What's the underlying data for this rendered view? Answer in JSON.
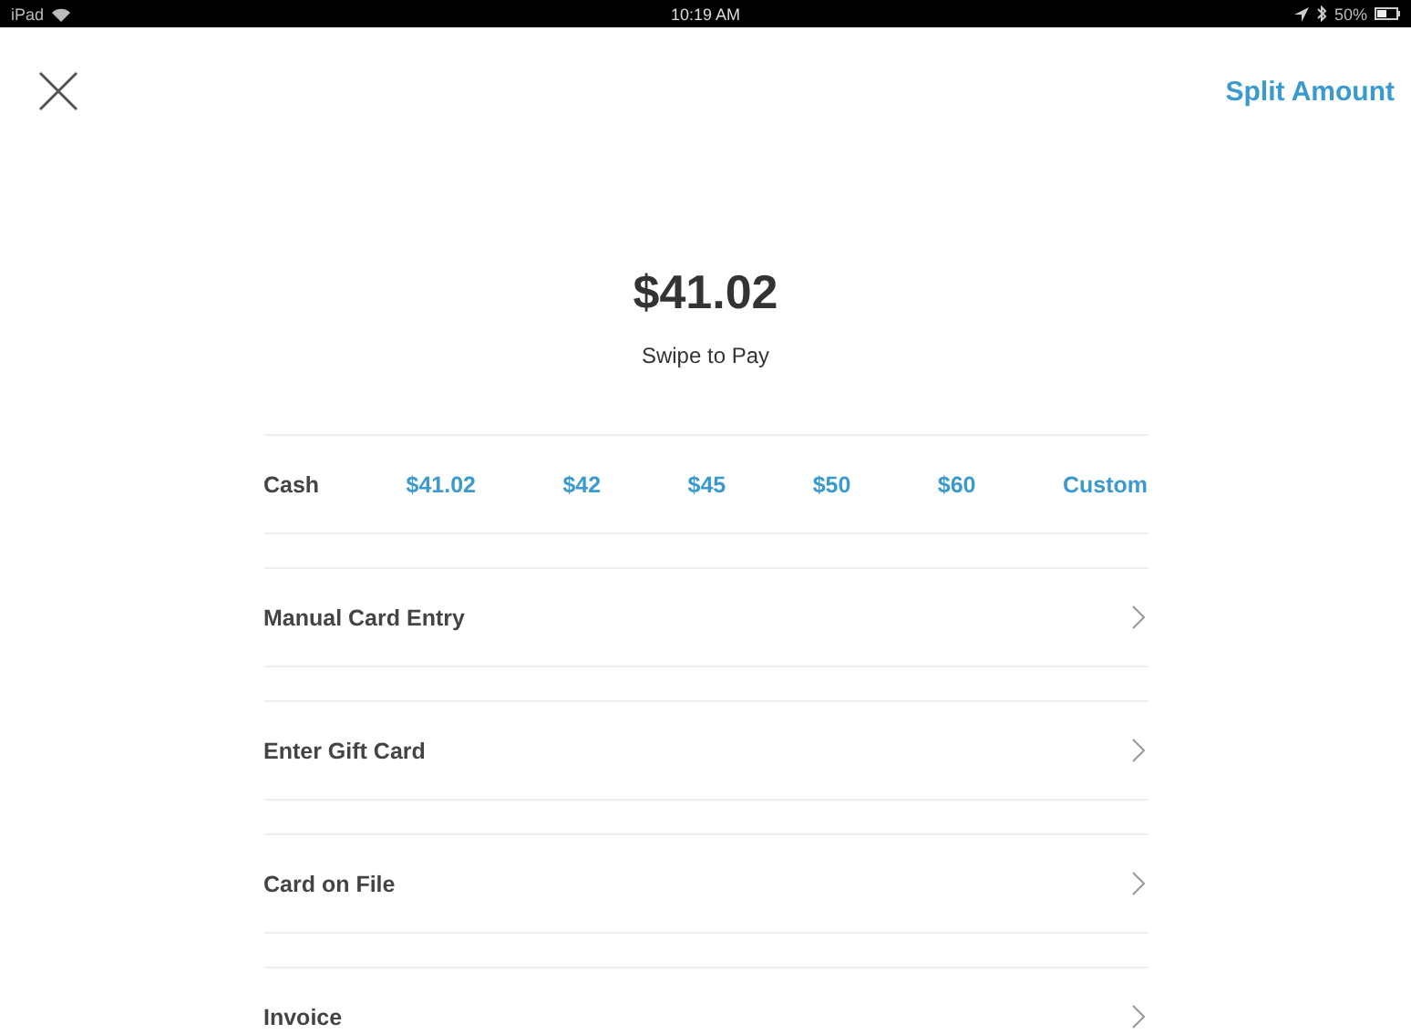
{
  "status_bar": {
    "device": "iPad",
    "time": "10:19 AM",
    "battery": "50%"
  },
  "header": {
    "action": "Split Amount"
  },
  "amount": "$41.02",
  "prompt": "Swipe to Pay",
  "cash": {
    "label": "Cash",
    "options": [
      "$41.02",
      "$42",
      "$45",
      "$50",
      "$60",
      "Custom"
    ]
  },
  "methods": [
    "Manual Card Entry",
    "Enter Gift Card",
    "Card on File",
    "Invoice"
  ]
}
